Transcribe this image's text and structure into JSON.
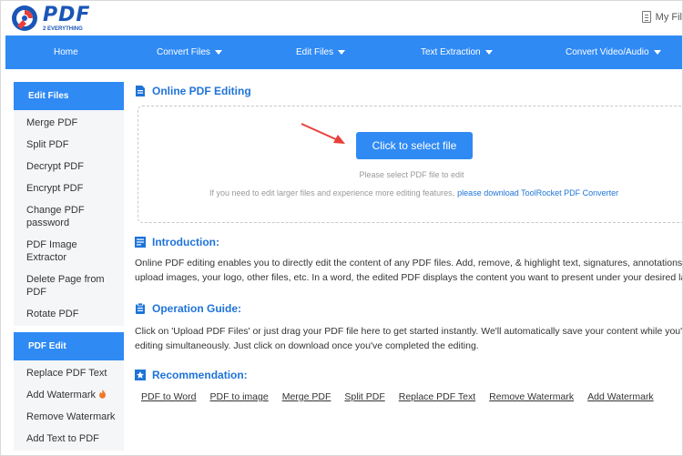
{
  "header": {
    "logo_text": "PDF",
    "logo_subtext": "2 EVERYTHING",
    "my_files_label": "My Fil"
  },
  "nav": {
    "items": [
      {
        "label": "Home",
        "has_caret": false
      },
      {
        "label": "Convert Files",
        "has_caret": true
      },
      {
        "label": "Edit Files",
        "has_caret": true
      },
      {
        "label": "Text Extraction",
        "has_caret": true
      },
      {
        "label": "Convert Video/Audio",
        "has_caret": true
      }
    ]
  },
  "sidebar": {
    "groups": [
      {
        "title": "Edit Files",
        "items": [
          "Merge PDF",
          "Split PDF",
          "Decrypt PDF",
          "Encrypt PDF",
          "Change PDF password",
          "PDF Image Extractor",
          "Delete Page from PDF",
          "Rotate PDF"
        ]
      },
      {
        "title": "PDF Edit",
        "items": [
          "Replace PDF Text",
          "Add Watermark",
          "Remove Watermark",
          "Add Text to PDF"
        ]
      }
    ]
  },
  "main": {
    "title": "Online PDF Editing",
    "upload": {
      "button_label": "Click to select file",
      "hint": "Please select PDF file to edit",
      "more_text": "If you need to edit larger files and experience more editing features,",
      "more_link": "please download ToolRocket PDF Converter"
    },
    "introduction": {
      "title": "Introduction:",
      "line1": "Online PDF editing enables you to directly edit the content of any PDF files. Add, remove, & highlight text, signatures, annotations,",
      "line2": "upload images, your logo, other files, etc. In a word, the edited PDF displays the content you want to present under your desired layo"
    },
    "guide": {
      "title": "Operation Guide:",
      "line1": "Click on 'Upload PDF Files' or just drag your PDF file here to get started instantly. We'll automatically save your content while you're",
      "line2": "editing simultaneously. Just click on download once you've completed the editing."
    },
    "recommendation": {
      "title": "Recommendation:",
      "links": [
        "PDF to Word",
        "PDF to image",
        "Merge PDF",
        "Split PDF",
        "Replace PDF Text",
        "Remove Watermark",
        "Add Watermark"
      ]
    }
  },
  "colors": {
    "accent": "#2f8af4",
    "link": "#1e73d8",
    "arrow": "#e8403a",
    "fire": "#f07a2b"
  }
}
